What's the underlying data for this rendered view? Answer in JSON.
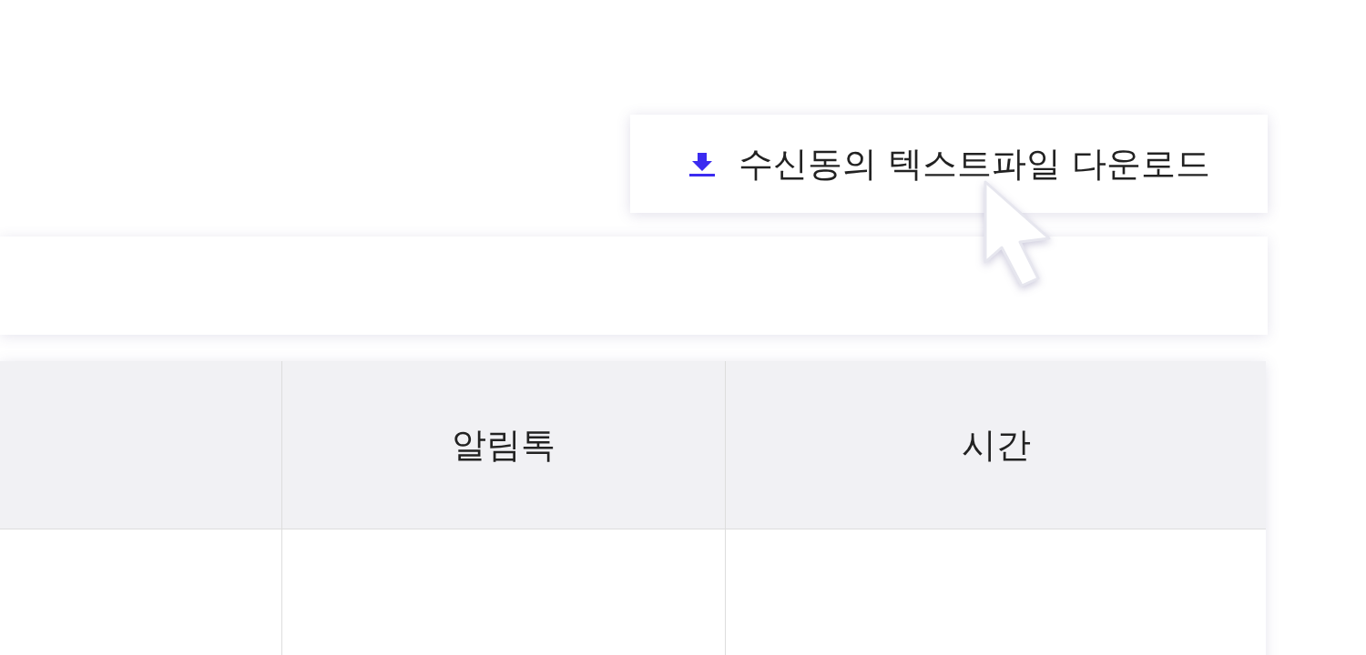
{
  "download_button": {
    "label": "수신동의 텍스트파일 다운로드"
  },
  "table": {
    "columns": [
      "알림톡",
      "시간"
    ]
  }
}
